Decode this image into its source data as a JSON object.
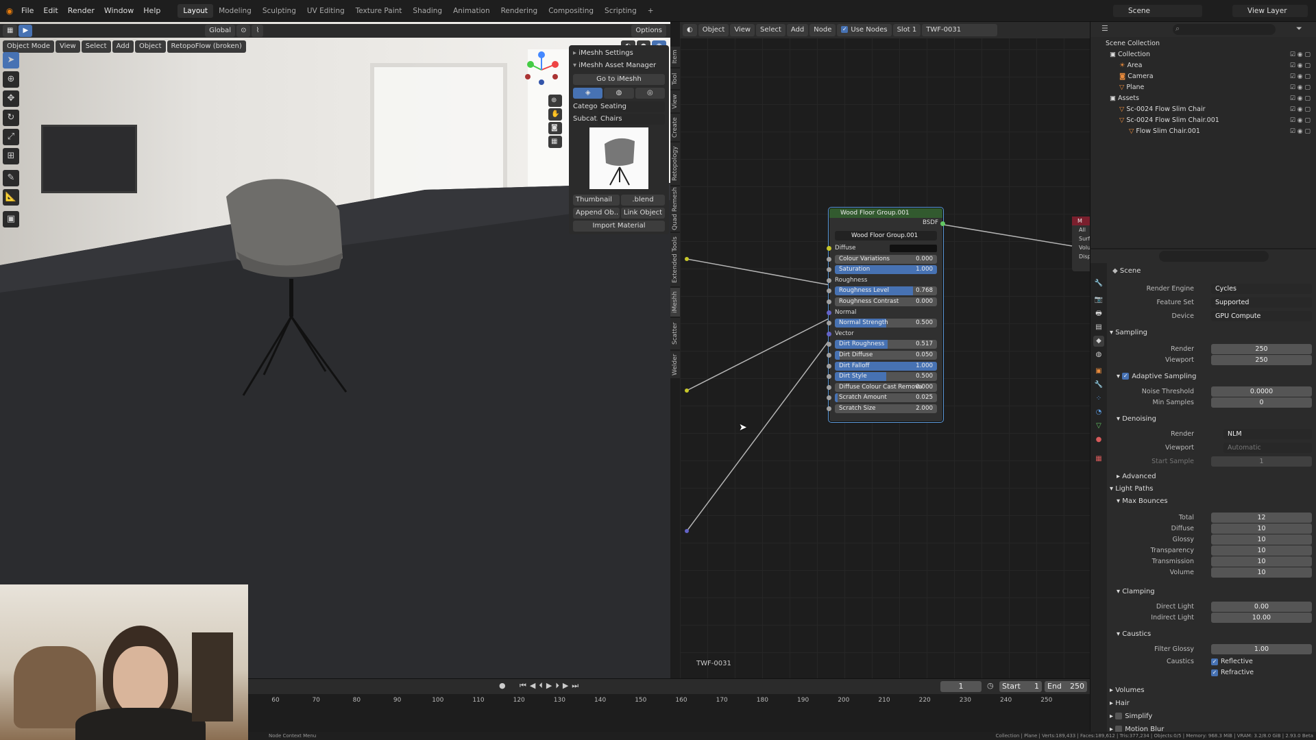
{
  "topbar": {
    "menus": [
      "File",
      "Edit",
      "Render",
      "Window",
      "Help"
    ],
    "workspaces": [
      "Layout",
      "Modeling",
      "Sculpting",
      "UV Editing",
      "Texture Paint",
      "Shading",
      "Animation",
      "Rendering",
      "Compositing",
      "Scripting"
    ],
    "active_workspace": "Layout",
    "add_tab": "+",
    "scene": "Scene",
    "view_layer": "View Layer"
  },
  "viewport": {
    "mode": "Object Mode",
    "menus": [
      "View",
      "Select",
      "Add",
      "Object"
    ],
    "retopo": "RetopoFlow (broken)",
    "orientation": "Global",
    "options": "Options",
    "side_tabs": [
      "Item",
      "Tool",
      "View",
      "Create",
      "Retopology",
      "Quad Remesh",
      "Extended Tools",
      "iMeshh",
      "Scatter",
      "Welder"
    ]
  },
  "imeshh": {
    "settings_title": "iMeshh Settings",
    "manager_title": "iMeshh Asset Manager",
    "goto_label": "Go to iMeshh",
    "category_label": "Catego..",
    "category_value": "Seating",
    "subcategory_label": "Subcat..",
    "subcategory_value": "Chairs",
    "thumbnail_label": "Thumbnail",
    "blend_label": ".blend",
    "append_label": "Append Ob..",
    "link_label": "Link Object",
    "import_label": "Import Material"
  },
  "node_editor": {
    "object_label": "Object",
    "menus": [
      "View",
      "Select",
      "Add",
      "Node"
    ],
    "use_nodes": "Use Nodes",
    "slot": "Slot 1",
    "material": "TWF-0031",
    "footer_label": "TWF-0031",
    "out_node_label": "M",
    "out_node_rows": [
      "All",
      "Surf",
      "Volu",
      "Disp"
    ]
  },
  "node": {
    "title": "Wood Floor Group.001",
    "output": "BSDF",
    "group_name": "Wood Floor Group.001",
    "rows": [
      {
        "label": "Diffuse",
        "type": "socket"
      },
      {
        "label": "Colour Variations",
        "value": "0.000",
        "fill": 0
      },
      {
        "label": "Saturation",
        "value": "1.000",
        "fill": 1
      },
      {
        "label": "Roughness",
        "type": "socket"
      },
      {
        "label": "Roughness Level",
        "value": "0.768",
        "fill": 0.768
      },
      {
        "label": "Roughness Contrast",
        "value": "0.000",
        "fill": 0
      },
      {
        "label": "Normal",
        "type": "socket"
      },
      {
        "label": "Normal Strength",
        "value": "0.500",
        "fill": 0.5
      },
      {
        "label": "Vector",
        "type": "socket"
      },
      {
        "label": "Dirt Roughness",
        "value": "0.517",
        "fill": 0.517
      },
      {
        "label": "Dirt Diffuse",
        "value": "0.050",
        "fill": 0.05
      },
      {
        "label": "Dirt Falloff",
        "value": "1.000",
        "fill": 1
      },
      {
        "label": "Dirt Style",
        "value": "0.500",
        "fill": 0.5
      },
      {
        "label": "Diffuse Colour Cast Remova",
        "value": "0.000",
        "fill": 0
      },
      {
        "label": "Scratch Amount",
        "value": "0.025",
        "fill": 0.025
      },
      {
        "label": "Scratch Size",
        "value": "2.000",
        "fill": 0
      }
    ]
  },
  "outliner": {
    "title": "Scene Collection",
    "rows": [
      {
        "label": "Collection",
        "level": 1
      },
      {
        "label": "Area",
        "level": 2
      },
      {
        "label": "Camera",
        "level": 2
      },
      {
        "label": "Plane",
        "level": 2
      },
      {
        "label": "Assets",
        "level": 1
      },
      {
        "label": "Sc-0024 Flow Slim Chair",
        "level": 2
      },
      {
        "label": "Sc-0024 Flow Slim Chair.001",
        "level": 2
      },
      {
        "label": "Flow Slim Chair.001",
        "level": 3
      }
    ]
  },
  "properties": {
    "context": "Scene",
    "render_engine_label": "Render Engine",
    "render_engine": "Cycles",
    "feature_set_label": "Feature Set",
    "feature_set": "Supported",
    "device_label": "Device",
    "device": "GPU Compute",
    "sampling": "Sampling",
    "render_label": "Render",
    "render_samples": "250",
    "viewport_label": "Viewport",
    "viewport_samples": "250",
    "adaptive": "Adaptive Sampling",
    "noise_label": "Noise Threshold",
    "noise": "0.0000",
    "min_samples_label": "Min Samples",
    "min_samples": "0",
    "denoising": "Denoising",
    "den_render_label": "Render",
    "den_render": "NLM",
    "den_viewport_label": "Viewport",
    "den_viewport": "Automatic",
    "start_sample_label": "Start Sample",
    "start_sample": "1",
    "advanced": "Advanced",
    "light_paths": "Light Paths",
    "max_bounces": "Max Bounces",
    "bounces": [
      {
        "label": "Total",
        "value": "12"
      },
      {
        "label": "Diffuse",
        "value": "10"
      },
      {
        "label": "Glossy",
        "value": "10"
      },
      {
        "label": "Transparency",
        "value": "10"
      },
      {
        "label": "Transmission",
        "value": "10"
      },
      {
        "label": "Volume",
        "value": "10"
      }
    ],
    "clamping": "Clamping",
    "direct_label": "Direct Light",
    "direct": "0.00",
    "indirect_label": "Indirect Light",
    "indirect": "10.00",
    "caustics": "Caustics",
    "filter_glossy_label": "Filter Glossy",
    "filter_glossy": "1.00",
    "caustics_label": "Caustics",
    "reflective": "Reflective",
    "refractive": "Refractive",
    "volumes": "Volumes",
    "hair": "Hair",
    "simplify": "Simplify",
    "motion_blur": "Motion Blur"
  },
  "timeline": {
    "frame": "1",
    "start_label": "Start",
    "start": "1",
    "end_label": "End",
    "end": "250",
    "ticks": [
      "60",
      "70",
      "80",
      "90",
      "100",
      "110",
      "120",
      "130",
      "140",
      "150",
      "160",
      "170",
      "180",
      "190",
      "200",
      "210",
      "220",
      "230",
      "240",
      "250"
    ]
  },
  "statusbar": {
    "left": "Node Context Menu",
    "right": "Collection | Plane | Verts:189,433 | Faces:189,612 | Tris:377,234 | Objects:0/5 | Memory: 968.3 MiB | VRAM: 3.2/8.0 GiB | 2.93.0 Beta"
  },
  "colors": {
    "accent": "#4772b3",
    "node_header": "#325a2f",
    "socket_yellow": "#c7c729",
    "socket_purple": "#6363c7",
    "socket_green": "#63c763"
  }
}
